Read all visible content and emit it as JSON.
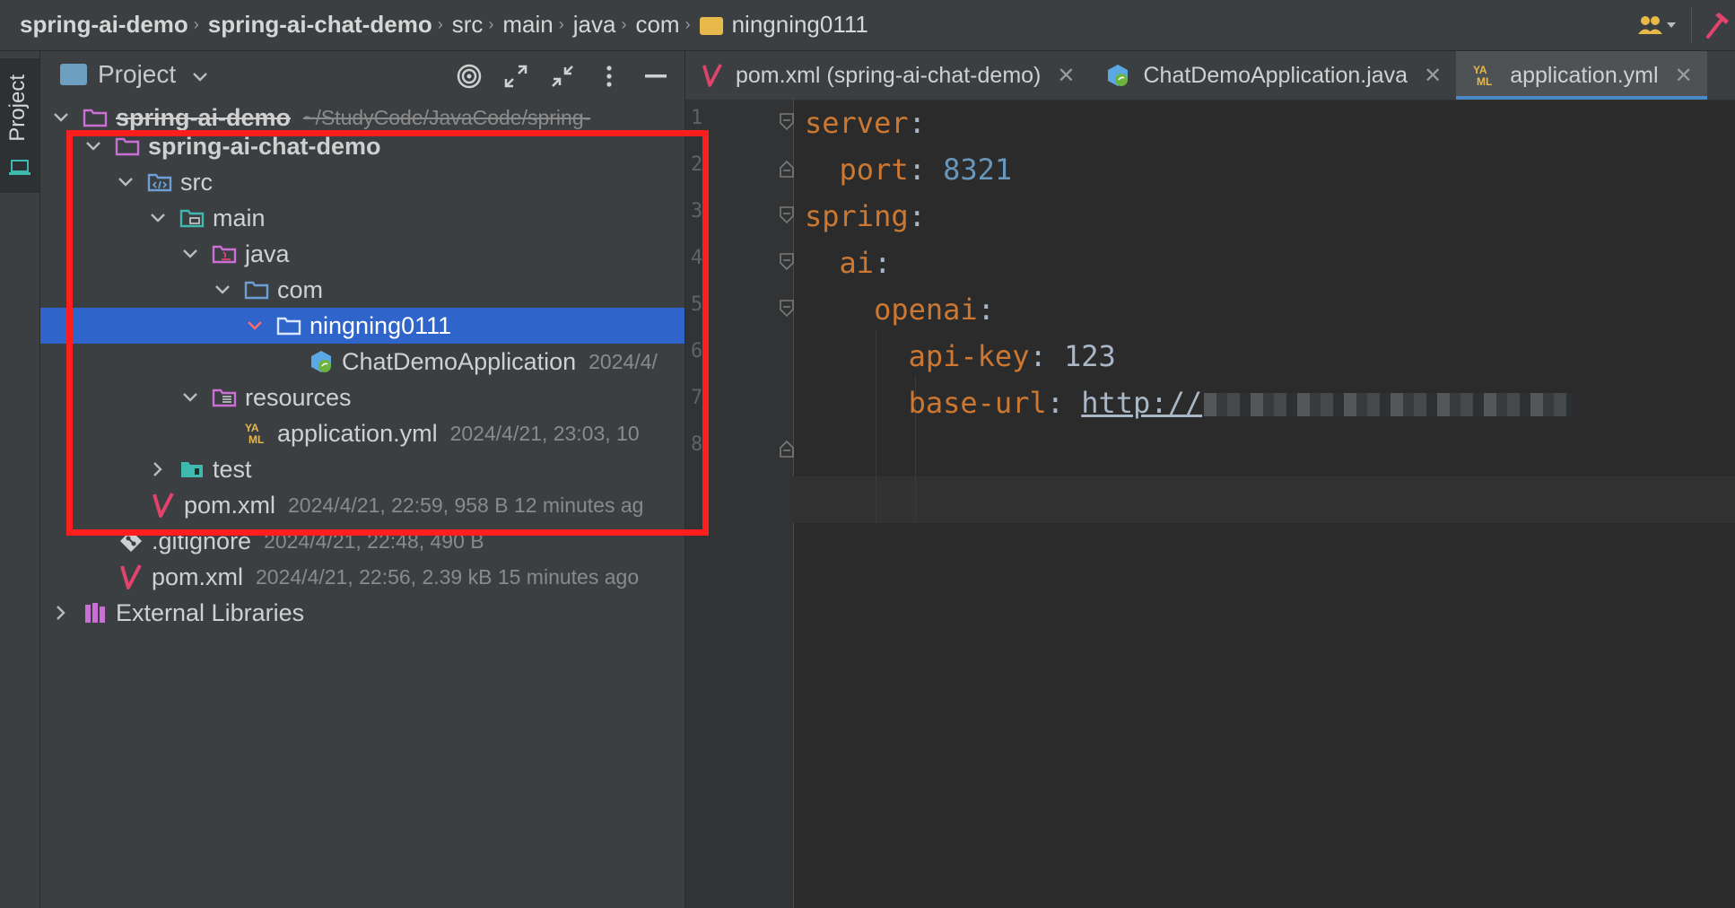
{
  "breadcrumbs": [
    "spring-ai-demo",
    "spring-ai-chat-demo",
    "src",
    "main",
    "java",
    "com",
    "ningning0111"
  ],
  "sidebar_strip": {
    "label": "Project"
  },
  "project_panel": {
    "title": "Project",
    "tree": [
      {
        "label": "spring-ai-demo",
        "meta": "~/StudyCode/JavaCode/spring-",
        "icon": "module-folder-icon",
        "expanded": true
      },
      {
        "label": "spring-ai-chat-demo",
        "meta": "",
        "icon": "module-folder-icon",
        "expanded": true
      },
      {
        "label": "src",
        "meta": "",
        "icon": "source-folder-icon",
        "expanded": true
      },
      {
        "label": "main",
        "meta": "",
        "icon": "folder-icon",
        "expanded": true
      },
      {
        "label": "java",
        "meta": "",
        "icon": "java-source-folder-icon",
        "expanded": true
      },
      {
        "label": "com",
        "meta": "",
        "icon": "package-folder-icon",
        "expanded": true
      },
      {
        "label": "ningning0111",
        "meta": "",
        "icon": "package-folder-icon",
        "expanded": true,
        "selected": true
      },
      {
        "label": "ChatDemoApplication",
        "meta": "2024/4/",
        "icon": "spring-class-icon"
      },
      {
        "label": "resources",
        "meta": "",
        "icon": "resources-folder-icon",
        "expanded": true
      },
      {
        "label": "application.yml",
        "meta": "2024/4/21, 23:03, 10",
        "icon": "yaml-file-icon"
      },
      {
        "label": "test",
        "meta": "",
        "icon": "test-folder-icon",
        "expanded": false
      },
      {
        "label": "pom.xml",
        "meta": "2024/4/21, 22:59, 958 B 12 minutes ag",
        "icon": "maven-icon"
      },
      {
        "label": ".gitignore",
        "meta": "2024/4/21, 22:48, 490 B",
        "icon": "git-icon"
      },
      {
        "label": "pom.xml",
        "meta": "2024/4/21, 22:56, 2.39 kB 15 minutes ago",
        "icon": "maven-icon"
      },
      {
        "label": "External Libraries",
        "meta": "",
        "icon": "libraries-icon",
        "expanded": false
      }
    ]
  },
  "editor": {
    "tabs": [
      {
        "label": "pom.xml (spring-ai-chat-demo)",
        "icon": "maven-icon"
      },
      {
        "label": "ChatDemoApplication.java",
        "icon": "spring-class-icon"
      },
      {
        "label": "application.yml",
        "icon": "yaml-file-icon",
        "active": true
      }
    ],
    "line_numbers": [
      "1",
      "2",
      "3",
      "4",
      "5",
      "6",
      "7",
      "8"
    ],
    "code": {
      "l1_key": "server",
      "l2_key": "port",
      "l2_val": "8321",
      "l3_key": "spring",
      "l4_key": "ai",
      "l5_key": "openai",
      "l6_key": "api-key",
      "l6_val": "123",
      "l7_key": "base-url",
      "l7_val": "http://"
    },
    "colon": ":"
  },
  "colors": {
    "selection": "#2f65ca",
    "highlight_box": "#ff1e1e",
    "yaml_key": "#cc7832",
    "yaml_number": "#6897bb"
  }
}
